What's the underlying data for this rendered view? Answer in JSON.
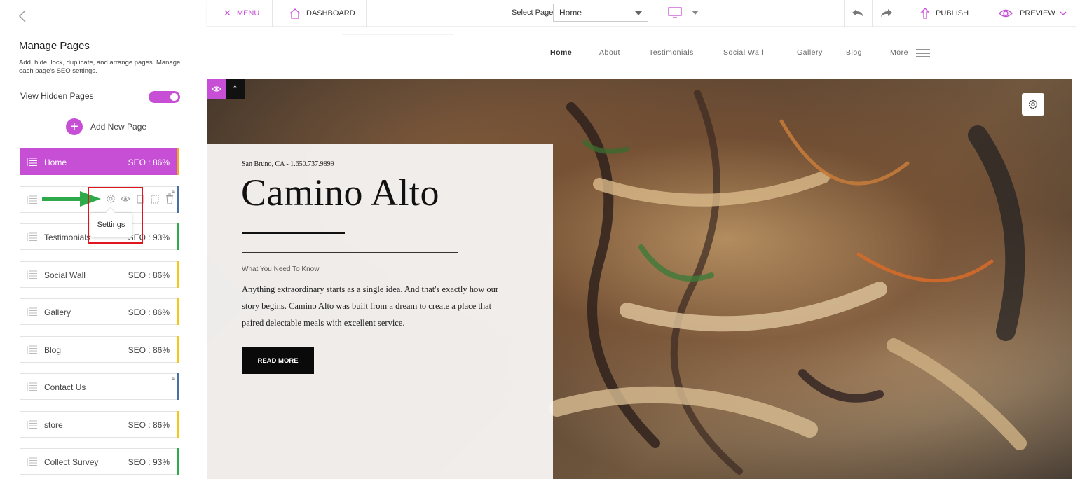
{
  "sidebar": {
    "title": "Manage Pages",
    "description": "Add, hide, lock, duplicate, and arrange pages. Manage each page's SEO settings.",
    "view_hidden_label": "View Hidden Pages",
    "view_hidden_on": true,
    "add_page_label": "Add New Page",
    "pages": [
      {
        "name": "Home",
        "seo": "SEO : 86%",
        "bar_color": "#f5a623",
        "active": true
      },
      {
        "name": "",
        "seo": "",
        "bar_color": "#4a6fa5",
        "locked": true
      },
      {
        "name": "Testimonials",
        "seo": "SEO : 93%",
        "bar_color": "#2eaa4a"
      },
      {
        "name": "Social Wall",
        "seo": "SEO : 86%",
        "bar_color": "#f5c518"
      },
      {
        "name": "Gallery",
        "seo": "SEO : 86%",
        "bar_color": "#f5c518"
      },
      {
        "name": "Blog",
        "seo": "SEO : 86%",
        "bar_color": "#f5c518"
      },
      {
        "name": "Contact Us",
        "seo": "",
        "bar_color": "#4a6fa5",
        "locked": true
      },
      {
        "name": "store",
        "seo": "SEO : 86%",
        "bar_color": "#f5c518"
      },
      {
        "name": "Collect Survey",
        "seo": "SEO : 93%",
        "bar_color": "#2eaa4a"
      }
    ],
    "tooltip": "Settings"
  },
  "toolbar": {
    "menu_label": "MENU",
    "dashboard_label": "DASHBOARD",
    "select_page_label": "Select Page",
    "select_page_value": "Home",
    "publish_label": "PUBLISH",
    "preview_label": "PREVIEW"
  },
  "site": {
    "nav": [
      "Home",
      "About",
      "Testimonials",
      "Social Wall",
      "Gallery",
      "Blog",
      "More"
    ],
    "location": "San Bruno, CA - 1.650.737.9899",
    "title": "Camino Alto",
    "subhead": "What You Need To Know",
    "body": "Anything extraordinary starts as a single idea. And that's exactly how our story begins. Camino Alto was built from a dream to create a place that paired delectable meals with excellent service.",
    "cta": "READ MORE"
  },
  "colors": {
    "accent": "#c64fd6",
    "highlight_box": "#e0161e",
    "arrow": "#2eaa4a"
  }
}
